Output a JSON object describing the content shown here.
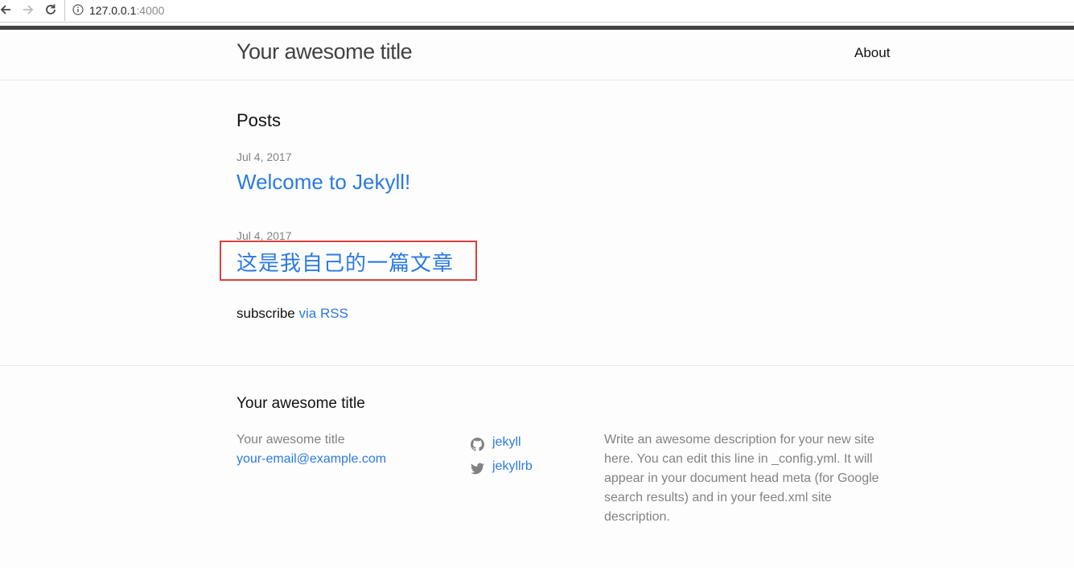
{
  "browser": {
    "url_host": "127.0.0.1",
    "url_port": ":4000"
  },
  "header": {
    "site_title": "Your awesome title",
    "nav": [
      {
        "label": "About"
      }
    ]
  },
  "main": {
    "heading": "Posts",
    "posts": [
      {
        "date": "Jul 4, 2017",
        "title": "Welcome to Jekyll!"
      },
      {
        "date": "Jul 4, 2017",
        "title": "这是我自己的一篇文章"
      }
    ],
    "subscribe_text": "subscribe",
    "rss_link": "via RSS"
  },
  "footer": {
    "heading": "Your awesome title",
    "site_name": "Your awesome title",
    "email": "your-email@example.com",
    "social": [
      {
        "icon": "github-icon",
        "label": "jekyll"
      },
      {
        "icon": "twitter-icon",
        "label": "jekyllrb"
      }
    ],
    "description": "Write an awesome description for your new site here. You can edit this line in _config.yml. It will appear in your document head meta (for Google search results) and in your feed.xml site description."
  },
  "colors": {
    "link": "#2a7ae2",
    "highlight_border": "#d9413d",
    "top_rule": "#424242",
    "muted_text": "#828282"
  }
}
